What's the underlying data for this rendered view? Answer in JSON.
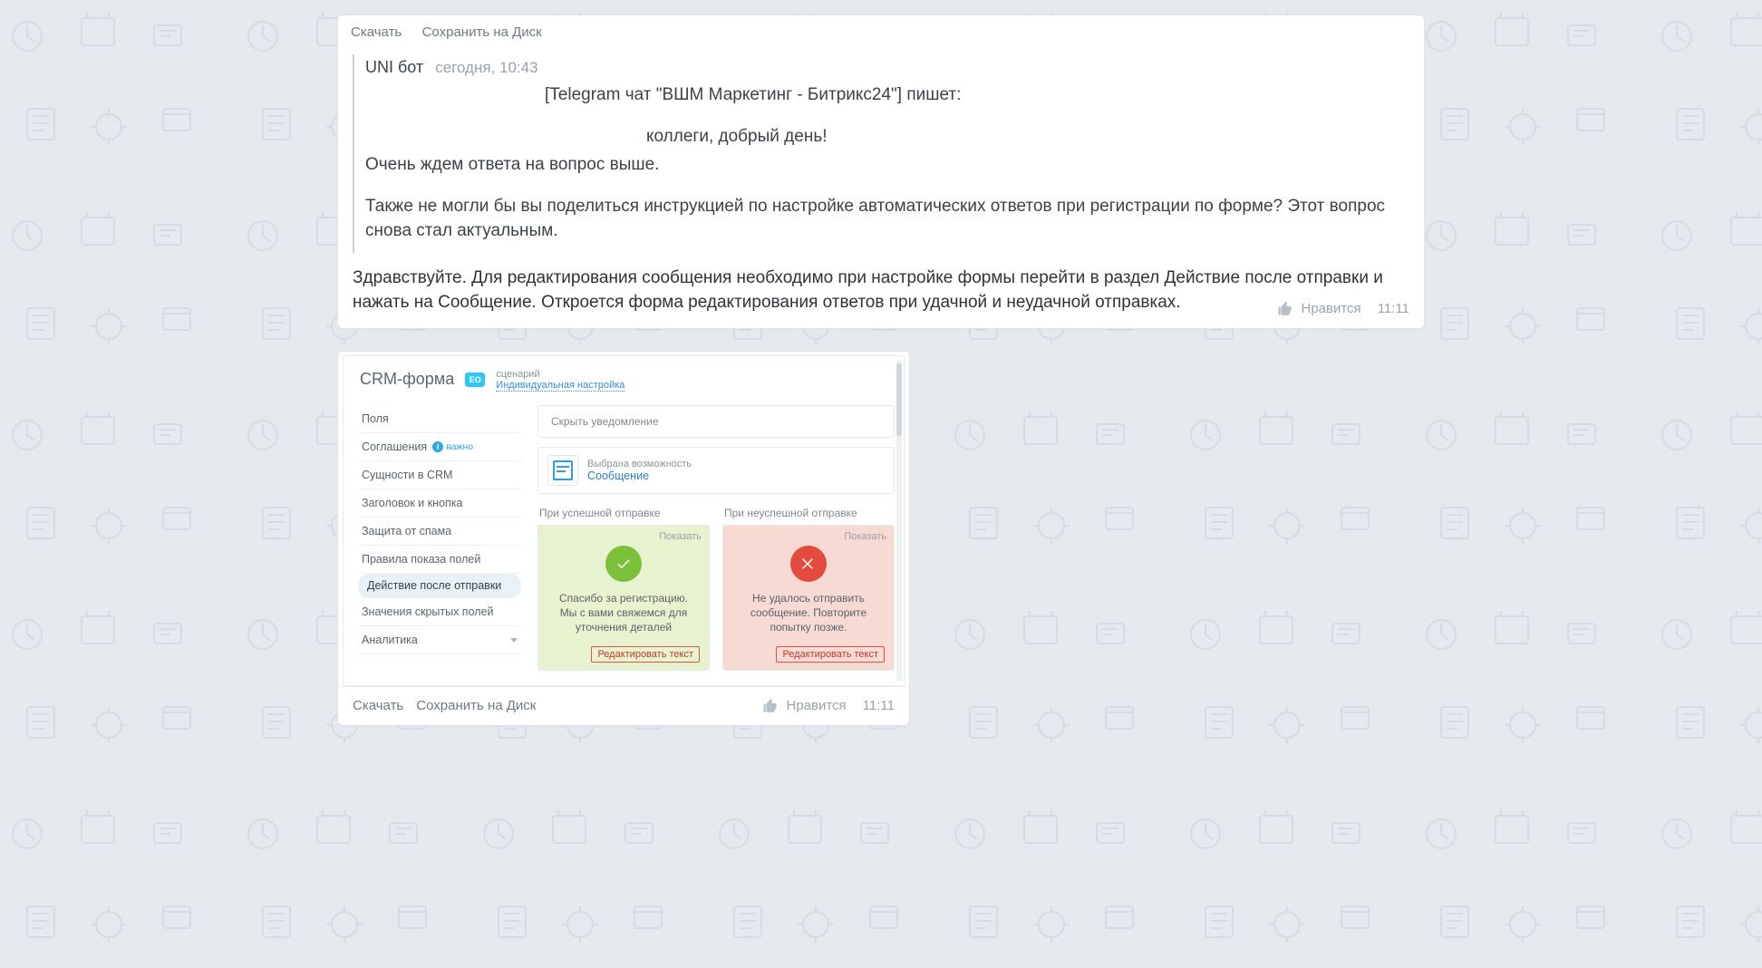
{
  "actions": {
    "download": "Скачать",
    "saveToDisk": "Сохранить на Диск",
    "like": "Нравится"
  },
  "post1": {
    "quote": {
      "sender": "UNI бот",
      "timestamp": "сегодня, 10:43",
      "line1": "[Telegram чат \"ВШМ Маркетинг - Битрикс24\"] пишет:",
      "line2": "коллеги, добрый день!",
      "line3": "Очень ждем ответа на вопрос выше.",
      "line4": "Также не могли бы вы поделиться инструкцией по настройке автоматических ответов при регистрации по форме? Этот вопрос снова стал актуальным."
    },
    "reply": "Здравствуйте. Для редактирования сообщения необходимо при настройке формы перейти в раздел Действие после отправки и нажать на Сообщение. Откроется форма редактирования ответов при удачной и неудачной отправках.",
    "replyMeta": {
      "time": "11:11"
    }
  },
  "post2": {
    "footer": {
      "time": "11:11"
    }
  },
  "crm": {
    "title": "CRM-форма",
    "badge": "EO",
    "sub1": "сценарий",
    "sub2": "Индивидуальная настройка",
    "side": {
      "fields": "Поля",
      "agreements": "Соглашения",
      "agreementsBadge": "важно",
      "entities": "Сущности в CRM",
      "headerBtn": "Заголовок и кнопка",
      "spam": "Защита от спама",
      "rules": "Правила показа полей",
      "action": "Действие после отправки",
      "hidden": "Значения скрытых полей",
      "analytics": "Аналитика"
    },
    "main": {
      "hideNotice": "Скрыть уведомление",
      "optLabel": "Выбрана возможность",
      "optValue": "Сообщение",
      "success": {
        "hdr": "При успешной отправке",
        "reveal": "Показать",
        "msg": "Спасибо за регистрацию. Мы с вами свяжемся для уточнения деталей",
        "edit": "Редактировать текст"
      },
      "fail": {
        "hdr": "При неуспешной отправке",
        "reveal": "Показать",
        "msg": "Не удалось отправить сообщение. Повторите попытку позже.",
        "edit": "Редактировать текст"
      }
    }
  }
}
